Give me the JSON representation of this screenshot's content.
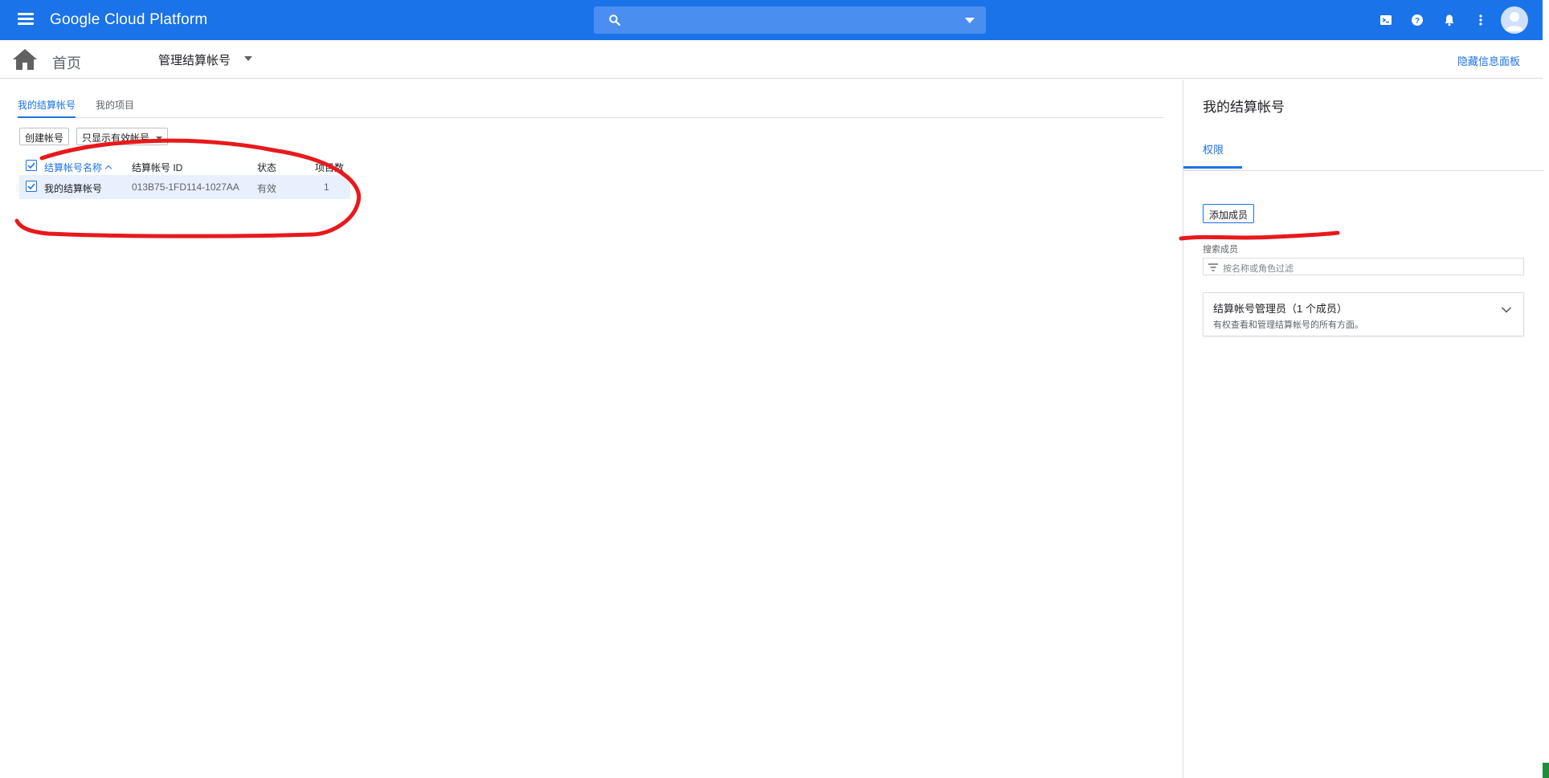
{
  "topbar": {
    "brand": "Google Cloud Platform",
    "search_placeholder": "",
    "icons": [
      "menu-icon",
      "search-icon",
      "cloud-shell-icon",
      "help-icon",
      "notifications-icon",
      "more-vert-icon",
      "account-avatar"
    ],
    "color": "#1a73e8"
  },
  "subbar": {
    "home_label": "首页",
    "page_title": "管理结算帐号",
    "hide_panel": "隐藏信息面板"
  },
  "main": {
    "tabs": [
      {
        "label": "我的结算帐号",
        "active": true
      },
      {
        "label": "我的项目",
        "active": false
      }
    ],
    "create_button": "创建帐号",
    "filter_button": "只显示有效帐号",
    "table": {
      "columns": [
        "结算帐号名称",
        "结算帐号 ID",
        "状态",
        "项目数"
      ],
      "rows": [
        {
          "name": "我的结算帐号",
          "id": "013B75-1FD114-1027AA",
          "status": "有效",
          "projects": "1",
          "checked": true
        }
      ]
    }
  },
  "panel": {
    "title": "我的结算帐号",
    "tab": "权限",
    "add_member": "添加成员",
    "search_label": "搜索成员",
    "search_placeholder": "按名称或角色过滤",
    "role": {
      "name": "结算帐号管理员（1 个成员）",
      "description": "有权查看和管理结算帐号的所有方面。"
    }
  },
  "colors": {
    "accent": "#1a73e8",
    "annotation": "#e8191c",
    "selected_row": "#e8f0fe"
  }
}
